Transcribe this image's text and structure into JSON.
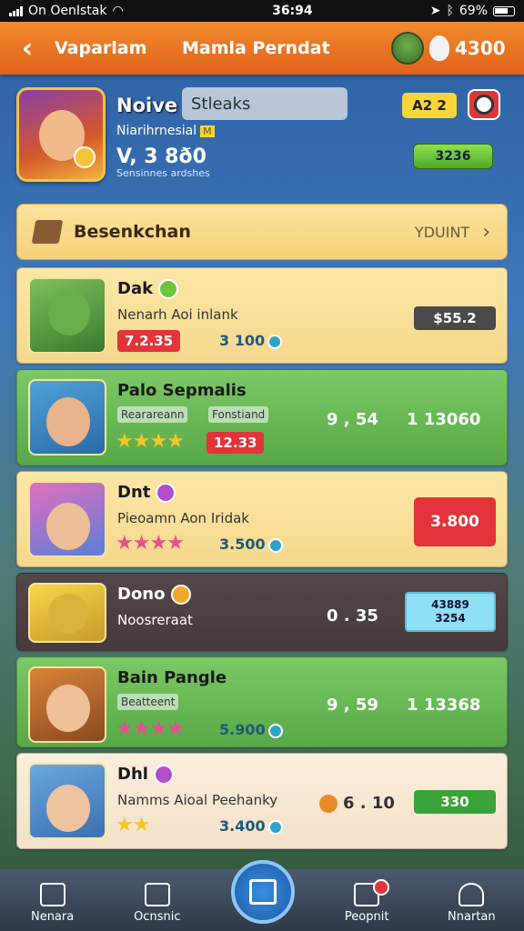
{
  "status_bar": {
    "carrier": "On OenIstak",
    "time": "36:94",
    "battery": "69%"
  },
  "header": {
    "back_label": "‹",
    "tab_label": "Vaparlam",
    "title": "Mamla Perndat",
    "coins": "4300"
  },
  "profile": {
    "name": "Noive",
    "search_value": "Stleaks",
    "subtitle": "Niarihrnesial",
    "level_tag": "M",
    "score": "V, 3 8ð0",
    "score_sub": "Sensinnes ardshes",
    "badge": "A2 2",
    "green_value": "3236"
  },
  "section": {
    "title": "Besenkchan",
    "link": "YDUINT",
    "chevron": "›"
  },
  "rows": [
    {
      "name": "Dak",
      "subtitle": "Nenarh Aoi inlank",
      "price": "7.2.35",
      "count": "3 100",
      "tag": "$55.2"
    },
    {
      "name": "Palo Sepmalis",
      "chip1": "Rearareann",
      "chip2": "Fonstiand",
      "stars": "★★★★",
      "price": "12.33",
      "value1": "9 , 54",
      "value2": "1  13060"
    },
    {
      "name": "Dnt",
      "subtitle": "Pieoamn Aon Iridak",
      "stars": "★★★★",
      "count": "3.500",
      "tag": "3.800"
    },
    {
      "name": "Dono",
      "subtitle": "Noosreraat",
      "value1": "0 . 35",
      "tag_line1": "43889",
      "tag_line2": "3254"
    },
    {
      "name": "Bain Pangle",
      "chip1": "Beatteent",
      "stars": "★★★★",
      "count": "5.900",
      "value1": "9 , 59",
      "value2": "1  13368"
    },
    {
      "name": "Dhl",
      "subtitle": "Namms Aioal Peehanky",
      "stars": "★★",
      "count": "3.400",
      "value1": "6 . 10",
      "tag": "330"
    }
  ],
  "bottom_nav": [
    {
      "label": "Nenara",
      "icon": "home-icon"
    },
    {
      "label": "Ocnsnic",
      "icon": "mail-icon"
    },
    {
      "label": "",
      "icon": "center-action-icon"
    },
    {
      "label": "Peopnit",
      "icon": "people-icon"
    },
    {
      "label": "Nnartan",
      "icon": "profile-icon"
    }
  ],
  "colors": {
    "header": "#e0631b",
    "accent_green": "#58a948",
    "accent_red": "#e2343a"
  }
}
